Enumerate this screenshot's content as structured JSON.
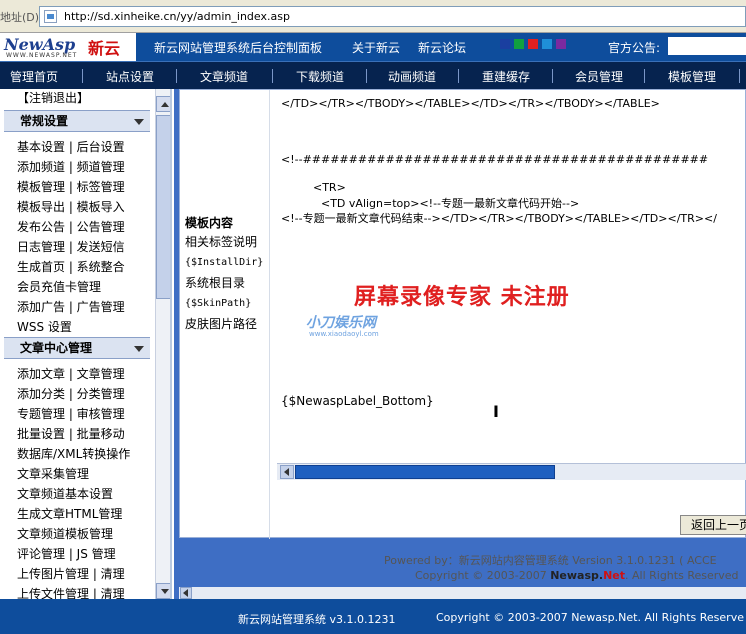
{
  "browser": {
    "address_label": "地址(D)",
    "url": "http://sd.xinheike.cn/yy/admin_index.asp"
  },
  "header": {
    "logo_text": "NewAsp",
    "logo_cn": "新云",
    "logo_sub": "WWW.NEWASP.NET",
    "title": "新云网站管理系统后台控制面板",
    "about": "关于新云",
    "forum": "新云论坛",
    "announce_label": "官方公告:",
    "theme_colors": [
      "#1a3fa0",
      "#10a040",
      "#e02020",
      "#1f8fd8",
      "#7a2aa0"
    ]
  },
  "nav": [
    "管理首页",
    "站点设置",
    "文章频道",
    "下载频道",
    "动画频道",
    "重建缓存",
    "会员管理",
    "模板管理"
  ],
  "sidebar": {
    "top_item": "【注销退出】",
    "sections": [
      {
        "title": "常规设置",
        "items": [
          "基本设置 | 后台设置",
          "添加频道 | 频道管理",
          "模板管理 | 标签管理",
          "模板导出 | 模板导入",
          "发布公告 | 公告管理",
          "日志管理 | 发送短信",
          "生成首页 | 系统整合",
          "会员充值卡管理",
          "添加广告 | 广告管理",
          "WSS 设置"
        ]
      },
      {
        "title": "文章中心管理",
        "items": [
          "添加文章 | 文章管理",
          "添加分类 | 分类管理",
          "专题管理 | 审核管理",
          "批量设置 | 批量移动",
          "数据库/XML转换操作",
          "文章采集管理",
          "文章频道基本设置",
          "生成文章HTML管理",
          "文章频道模板管理",
          "评论管理 | JS 管理",
          "上传图片管理 | 清理",
          "上传文件管理 | 清理"
        ]
      }
    ]
  },
  "tag_panel": {
    "heading": "模板内容",
    "related": "相关标签说明",
    "tag1": "{$InstallDir}",
    "tag1_desc": "系统根目录",
    "tag2": "{$SkinPath}",
    "tag2_desc": "皮肤图片路径"
  },
  "editor": {
    "lines": [
      "</TD></TR></TBODY></TABLE></TD></TR></TBODY></TABLE>",
      "<!--############################################",
      "<TR>",
      "<TD vAlign=top><!--专题一最新文章代码开始-->",
      "<!--专题一最新文章代码结束--></TD></TR></TBODY></TABLE></TD></TR></",
      "{$NewaspLabel_Bottom}"
    ]
  },
  "watermark": {
    "main": "屏幕录像专家  未注册",
    "sub": "小刀娱乐网",
    "sub_url": "www.xiaodaoyl.com"
  },
  "buttons": {
    "back": "返回上一页"
  },
  "powered": {
    "line1": "Powered by：新云网站内容管理系统 Version 3.1.0.1231 ( ACCE",
    "line2_pre": "Copyright © 2003-2007 ",
    "line2_brand": "Newasp.",
    "line2_net": "Net",
    "line2_post": ". All Rights Reserved"
  },
  "footer": {
    "left": "新云网站管理系统 v3.1.0.1231",
    "right": "Copyright © 2003-2007 Newasp.Net. All Rights Reserve"
  }
}
